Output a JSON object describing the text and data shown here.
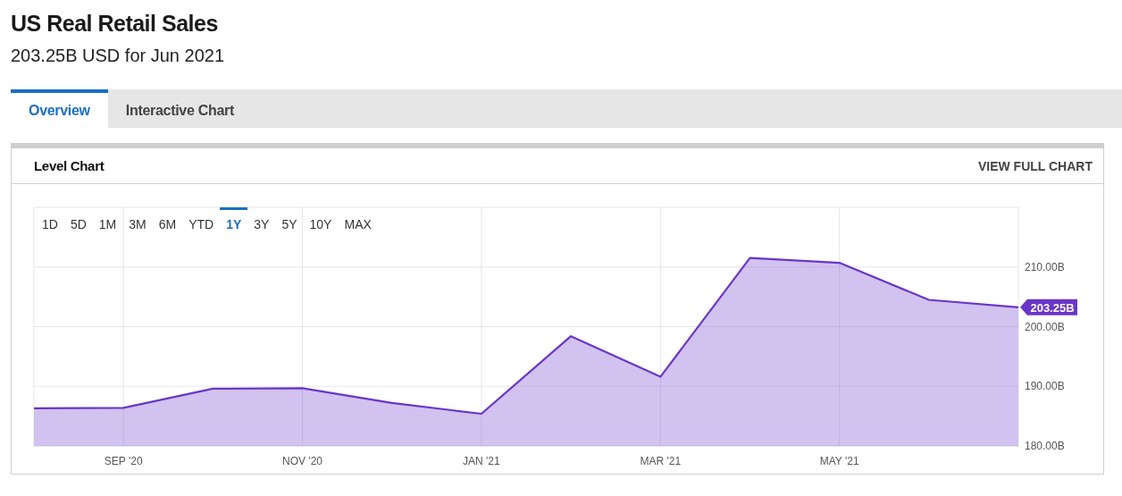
{
  "header": {
    "title": "US Real Retail Sales",
    "subtitle": "203.25B USD for Jun 2021"
  },
  "tabs": [
    {
      "label": "Overview",
      "selected": true
    },
    {
      "label": "Interactive Chart",
      "selected": false
    }
  ],
  "card": {
    "title": "Level Chart",
    "action": "VIEW FULL CHART",
    "ranges": [
      {
        "label": "1D",
        "selected": false
      },
      {
        "label": "5D",
        "selected": false
      },
      {
        "label": "1M",
        "selected": false
      },
      {
        "label": "3M",
        "selected": false
      },
      {
        "label": "6M",
        "selected": false
      },
      {
        "label": "YTD",
        "selected": false
      },
      {
        "label": "1Y",
        "selected": true
      },
      {
        "label": "3Y",
        "selected": false
      },
      {
        "label": "5Y",
        "selected": false
      },
      {
        "label": "10Y",
        "selected": false
      },
      {
        "label": "MAX",
        "selected": false
      }
    ],
    "chart_data": {
      "type": "area",
      "categories": [
        null,
        "SEP '20",
        null,
        "NOV '20",
        null,
        "JAN '21",
        null,
        "MAR '21",
        null,
        "MAY '21",
        null,
        null
      ],
      "series": [
        {
          "color": "#6a35c9",
          "values": [
            186.3,
            186.4,
            189.6,
            189.7,
            187.2,
            185.4,
            198.4,
            191.6,
            211.5,
            210.7,
            204.5,
            203.25
          ]
        }
      ],
      "ylim": [
        180,
        220
      ],
      "yticks": [
        {
          "value": 180,
          "label": "180.00B"
        },
        {
          "value": 190,
          "label": "190.00B"
        },
        {
          "value": 200,
          "label": "200.00B"
        },
        {
          "value": 210,
          "label": "210.00B"
        }
      ],
      "grid": true,
      "annotations": [
        "203.25B"
      ]
    }
  }
}
